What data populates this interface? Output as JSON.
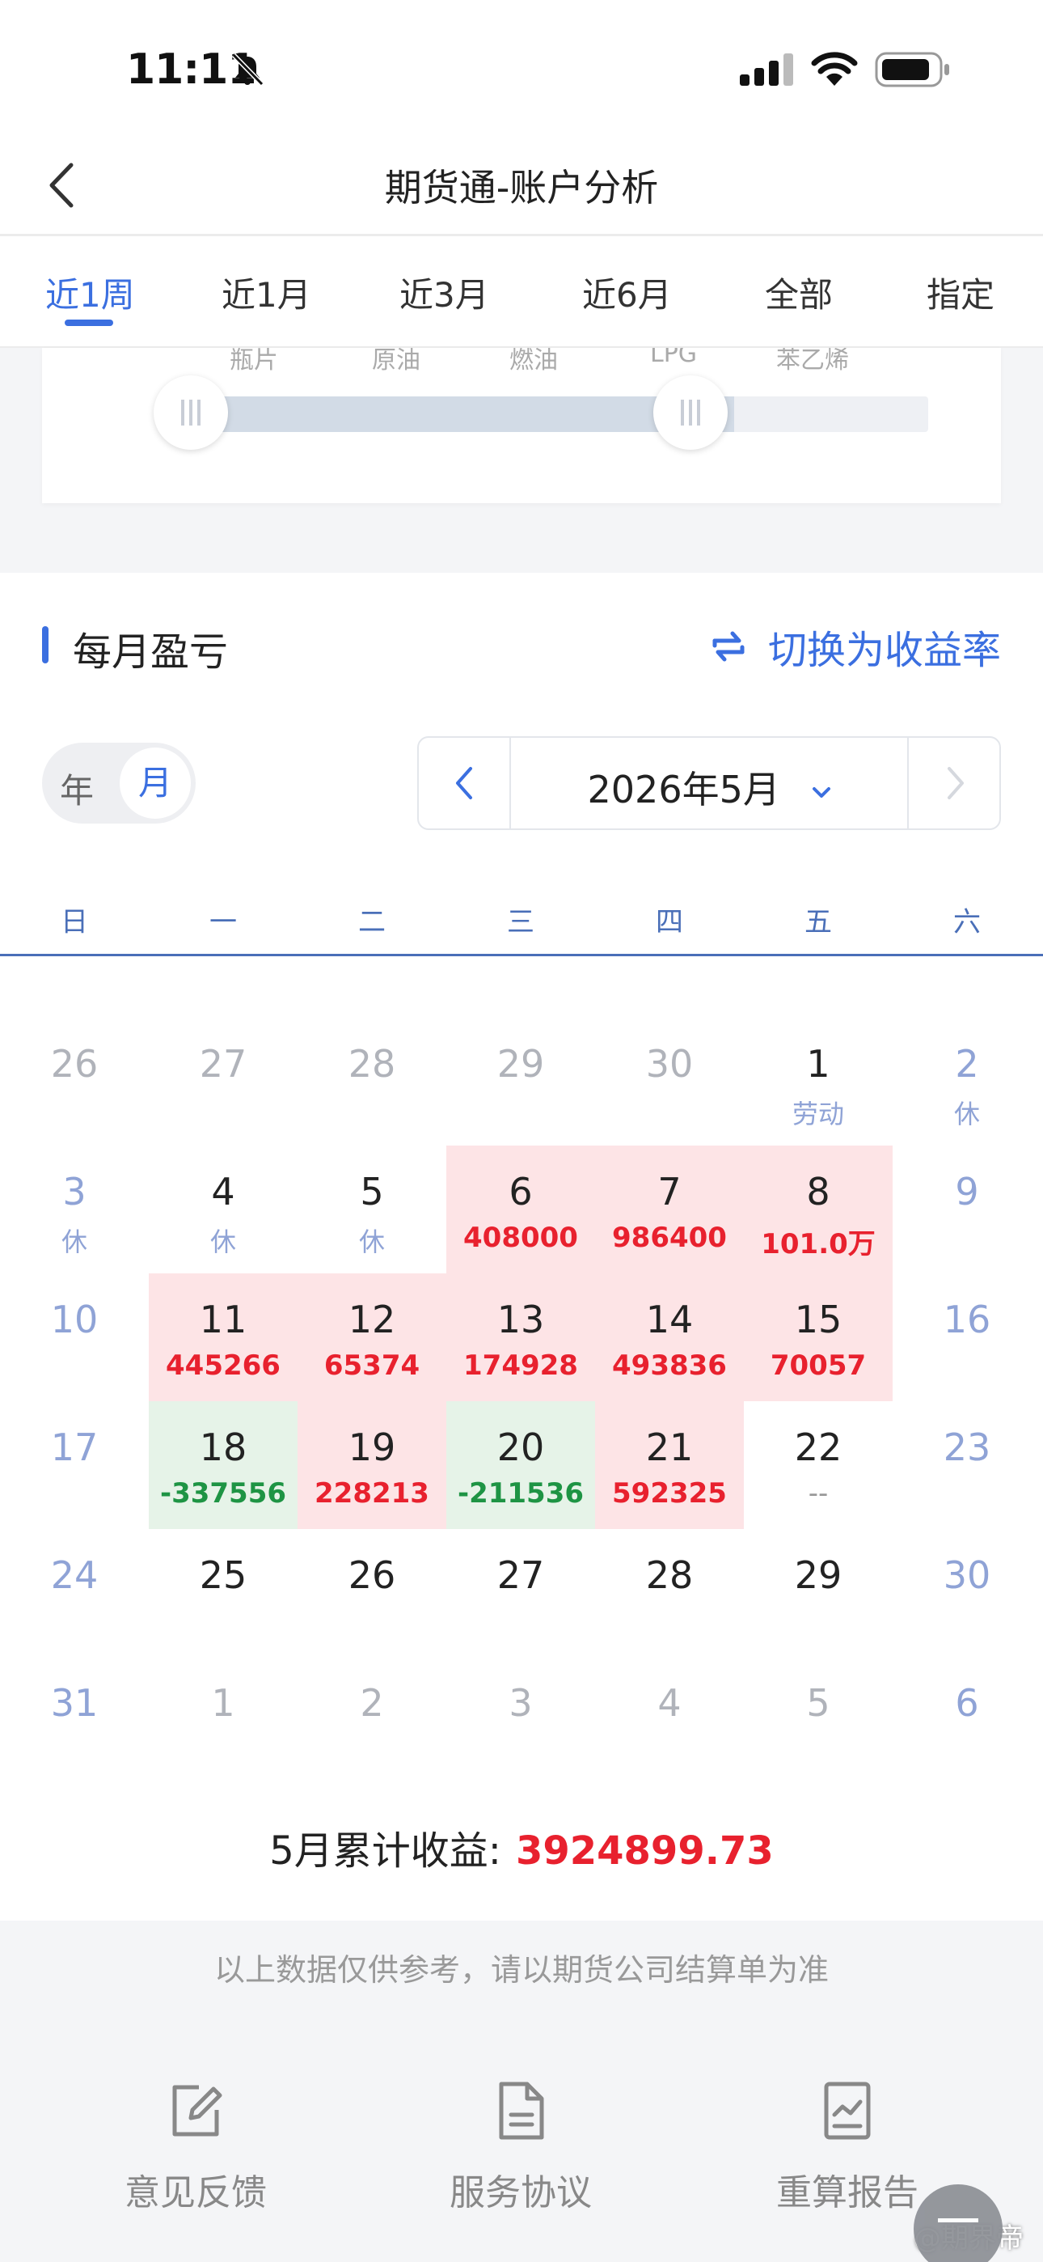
{
  "status_bar": {
    "time": "11:11"
  },
  "nav": {
    "title": "期货通-账户分析"
  },
  "tabs": [
    {
      "label": "近1周",
      "active": true
    },
    {
      "label": "近1月",
      "active": false
    },
    {
      "label": "近3月",
      "active": false
    },
    {
      "label": "近6月",
      "active": false
    },
    {
      "label": "全部",
      "active": false
    },
    {
      "label": "指定",
      "active": false
    }
  ],
  "slider": {
    "labels": [
      "瓶片",
      "原油",
      "燃油",
      "LPG",
      "苯乙烯"
    ]
  },
  "monthly_pnl": {
    "title": "每月盈亏",
    "switch_label": "切换为收益率",
    "toggle": {
      "year": "年",
      "month": "月",
      "selected": "月"
    },
    "picker": {
      "label": "2026年5月"
    },
    "weekdays": [
      "日",
      "一",
      "二",
      "三",
      "四",
      "五",
      "六"
    ],
    "total_label": "5月累计收益:",
    "total_value": "3924899.73"
  },
  "calendar_days": [
    {
      "d": "26",
      "kind": "other"
    },
    {
      "d": "27",
      "kind": "other"
    },
    {
      "d": "28",
      "kind": "other"
    },
    {
      "d": "29",
      "kind": "other"
    },
    {
      "d": "30",
      "kind": "other"
    },
    {
      "d": "1",
      "kind": "holiday",
      "sub": "劳动"
    },
    {
      "d": "2",
      "kind": "weekend",
      "sub": "休"
    },
    {
      "d": "3",
      "kind": "weekend",
      "sub": "休"
    },
    {
      "d": "4",
      "kind": "holiday",
      "sub": "休"
    },
    {
      "d": "5",
      "kind": "holiday",
      "sub": "休"
    },
    {
      "d": "6",
      "kind": "pos",
      "sub": "408000"
    },
    {
      "d": "7",
      "kind": "pos",
      "sub": "986400"
    },
    {
      "d": "8",
      "kind": "pos",
      "sub": "101.0万"
    },
    {
      "d": "9",
      "kind": "weekend"
    },
    {
      "d": "10",
      "kind": "weekend"
    },
    {
      "d": "11",
      "kind": "pos",
      "sub": "445266"
    },
    {
      "d": "12",
      "kind": "pos",
      "sub": "65374"
    },
    {
      "d": "13",
      "kind": "pos",
      "sub": "174928"
    },
    {
      "d": "14",
      "kind": "pos",
      "sub": "493836"
    },
    {
      "d": "15",
      "kind": "pos",
      "sub": "70057"
    },
    {
      "d": "16",
      "kind": "weekend"
    },
    {
      "d": "17",
      "kind": "weekend"
    },
    {
      "d": "18",
      "kind": "neg",
      "sub": "-337556"
    },
    {
      "d": "19",
      "kind": "pos",
      "sub": "228213"
    },
    {
      "d": "20",
      "kind": "neg",
      "sub": "-211536"
    },
    {
      "d": "21",
      "kind": "pos",
      "sub": "592325"
    },
    {
      "d": "22",
      "kind": "empty",
      "sub": "--"
    },
    {
      "d": "23",
      "kind": "weekend"
    },
    {
      "d": "24",
      "kind": "weekend"
    },
    {
      "d": "25",
      "kind": "normal"
    },
    {
      "d": "26",
      "kind": "normal"
    },
    {
      "d": "27",
      "kind": "normal"
    },
    {
      "d": "28",
      "kind": "normal"
    },
    {
      "d": "29",
      "kind": "normal"
    },
    {
      "d": "30",
      "kind": "weekend"
    },
    {
      "d": "31",
      "kind": "weekend"
    },
    {
      "d": "1",
      "kind": "other"
    },
    {
      "d": "2",
      "kind": "other"
    },
    {
      "d": "3",
      "kind": "other"
    },
    {
      "d": "4",
      "kind": "other"
    },
    {
      "d": "5",
      "kind": "other"
    },
    {
      "d": "6",
      "kind": "weekend"
    }
  ],
  "footer": {
    "disclaimer": "以上数据仅供参考，请以期货公司结算单为准",
    "buttons": [
      "意见反馈",
      "服务协议",
      "重算报告"
    ],
    "watermark": "@期界帝"
  },
  "colors": {
    "accent": "#3b6fe0",
    "profit": "#e8212e",
    "loss": "#1e9444"
  }
}
